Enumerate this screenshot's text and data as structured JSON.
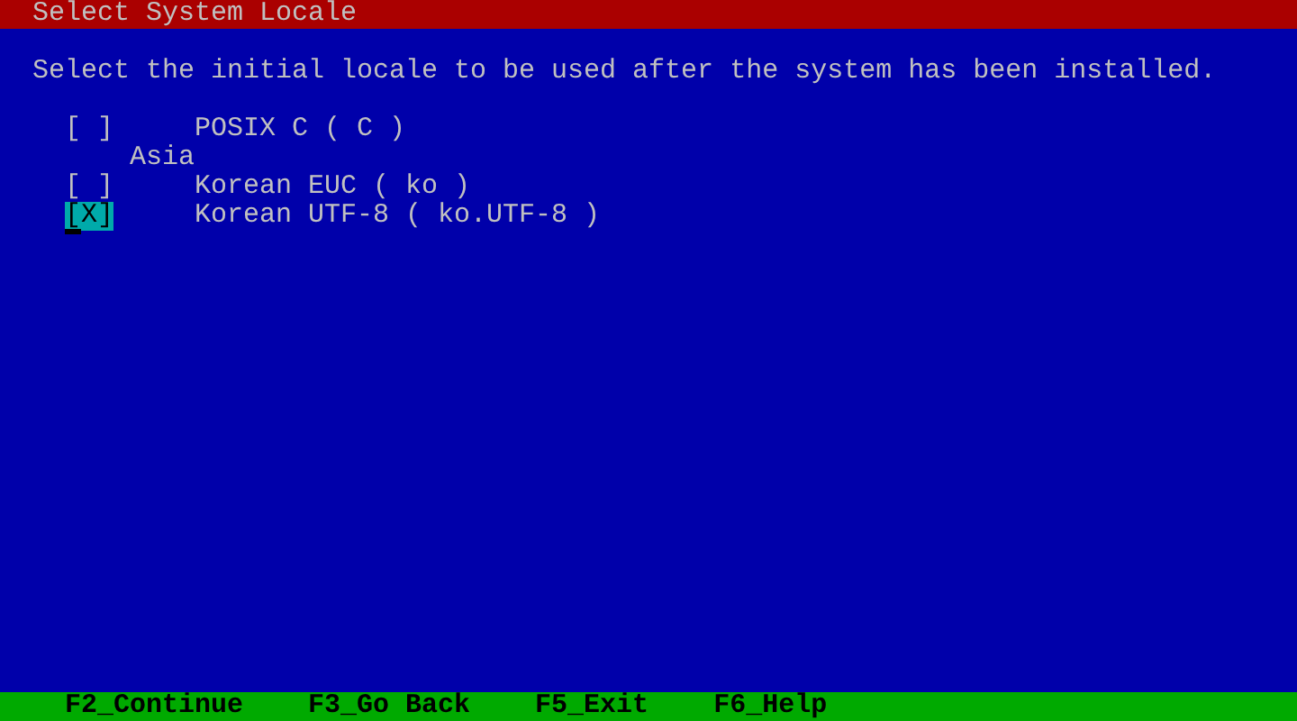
{
  "window": {
    "title": "Select System Locale"
  },
  "instruction": "Select the initial locale to be used after the system has been installed.",
  "items": [
    {
      "kind": "option",
      "box": "[ ]",
      "label": "POSIX C ( C )",
      "focused": false
    },
    {
      "kind": "group",
      "label": "Asia"
    },
    {
      "kind": "option",
      "box": "[ ]",
      "label": "Korean EUC ( ko )",
      "focused": false
    },
    {
      "kind": "option",
      "box": "[X]",
      "label": "Korean UTF-8 ( ko.UTF-8 )",
      "focused": true
    }
  ],
  "function_keys": [
    "F2_Continue",
    "F3_Go Back",
    "F5_Exit",
    "F6_Help"
  ]
}
